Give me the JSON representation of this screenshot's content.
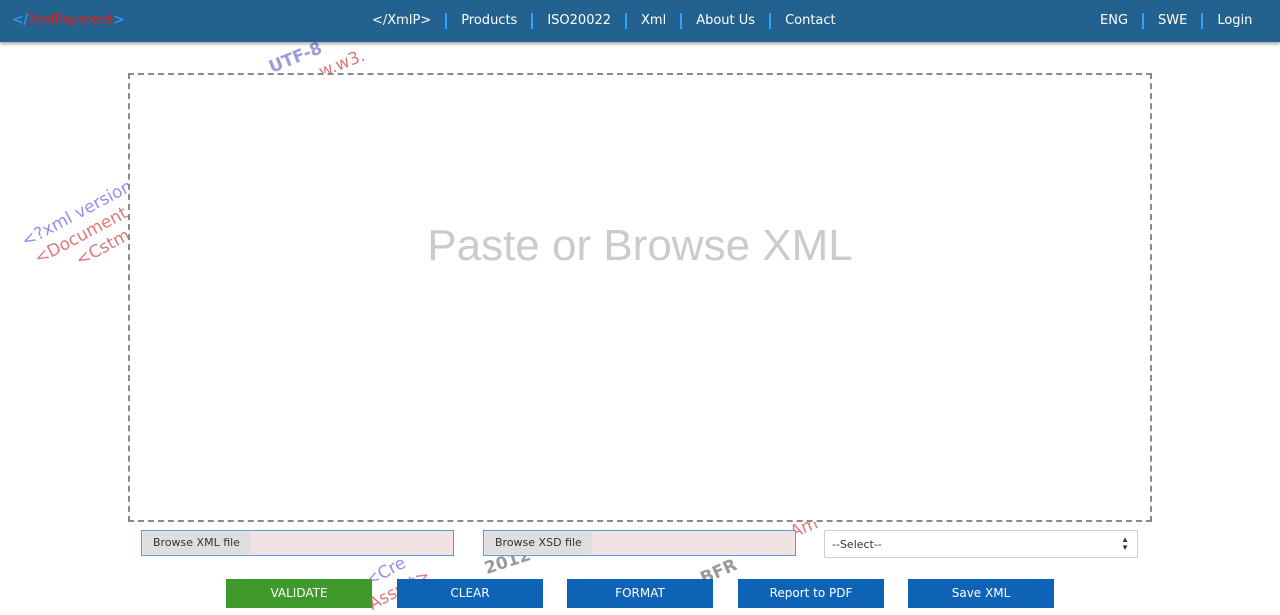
{
  "brand": {
    "tag_open": "</",
    "name": "XmlPayment",
    "tag_close": ">"
  },
  "nav": {
    "center": [
      "</XmlP>",
      "Products",
      "ISO20022",
      "Xml",
      "About Us",
      "Contact"
    ],
    "right": [
      "ENG",
      "SWE",
      "Login"
    ]
  },
  "editor": {
    "placeholder": "Paste or Browse XML"
  },
  "files": {
    "xml_button": "Browse XML file",
    "xsd_button": "Browse XSD file"
  },
  "select": {
    "selected": "--Select--"
  },
  "buttons": {
    "validate": "VALIDATE",
    "clear": "CLEAR",
    "format": "FORMAT",
    "pdf": "Report to PDF",
    "save": "Save XML"
  },
  "watermark": {
    "line1": "<?xml version",
    "line2": "<Document",
    "line3": "<Cstm",
    "top1": "UTF-8",
    "top2": "w.w3.",
    "bottom1": "<Cre",
    "bottom2": "Assmt>",
    "bottom3": "2012",
    "bottom4": "BFR",
    "bottom5": "Am"
  },
  "colors": {
    "header": "#23628f",
    "validate": "#3f9a2b",
    "action": "#0e63b6",
    "separator": "#2ba4ff",
    "brand_name": "#e0201b",
    "brand_tag": "#3aa0ff"
  }
}
